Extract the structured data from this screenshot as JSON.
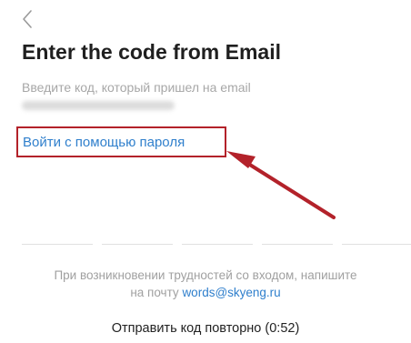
{
  "nav": {
    "back_icon": "chevron-left-icon"
  },
  "header": {
    "title": "Enter the code from Email",
    "subtitle": "Введите код, который пришел на email"
  },
  "password_login": {
    "label": "Войти с помощью пароля"
  },
  "code_input": {
    "slots": 5
  },
  "help": {
    "line1": "При возникновении трудностей со входом, напишите",
    "line2_prefix": "на почту",
    "email": "words@skyeng.ru"
  },
  "resend": {
    "label": "Отправить код повторно (0:52)"
  },
  "colors": {
    "accent_link": "#2f7fcc",
    "annotation_red": "#b3222a",
    "muted_text": "#a0a0a0"
  }
}
